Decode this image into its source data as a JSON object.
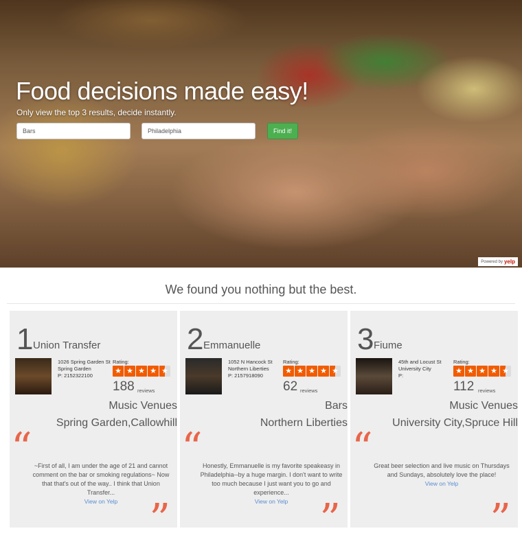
{
  "hero": {
    "title": "Food decisions made easy!",
    "subtitle": "Only view the top 3 results, decide instantly.",
    "term_value": "Bars",
    "location_value": "Philadelphia",
    "find_button": "Find it!",
    "powered_by": "Powered by",
    "yelp": "yelp"
  },
  "results": {
    "headline": "We found you nothing but the best.",
    "rating_label": "Rating:",
    "reviews_word": "reviews",
    "view_on_yelp": "View on Yelp",
    "items": [
      {
        "rank": "1",
        "name": "Union Transfer",
        "address1": "1026 Spring Garden St",
        "address2": "Spring Garden",
        "phone": "P: 2152322100",
        "rating": 4.5,
        "review_count": "188",
        "category": "Music Venues",
        "neighborhood": "Spring Garden,Callowhill",
        "review": "~First of all, I am under the age of 21 and cannot comment on the bar or smoking regulations~ Now that that's out of the way.. I think that Union Transfer..."
      },
      {
        "rank": "2",
        "name": "Emmanuelle",
        "address1": "1052 N Hancock St",
        "address2": "Northern Liberties",
        "phone": "P: 2157918090",
        "rating": 4.5,
        "review_count": "62",
        "category": "Bars",
        "neighborhood": "Northern Liberties",
        "review": "Honestly, Emmanuelle is my favorite speakeasy in Philadelphia--by a huge margin. I don't want to write too much because I just want you to go and experience..."
      },
      {
        "rank": "3",
        "name": "Fiume",
        "address1": "45th and Locust St",
        "address2": "University City",
        "phone": "P:",
        "rating": 4.5,
        "review_count": "112",
        "category": "Music Venues",
        "neighborhood": "University City,Spruce Hill",
        "review": "Great beer selection and live music on Thursdays and Sundays, absolutely love the place!"
      }
    ]
  },
  "colors": {
    "star": "#f15c00",
    "quote": "#e8654a",
    "find_button": "#4caf50",
    "link": "#5a8dd0"
  }
}
